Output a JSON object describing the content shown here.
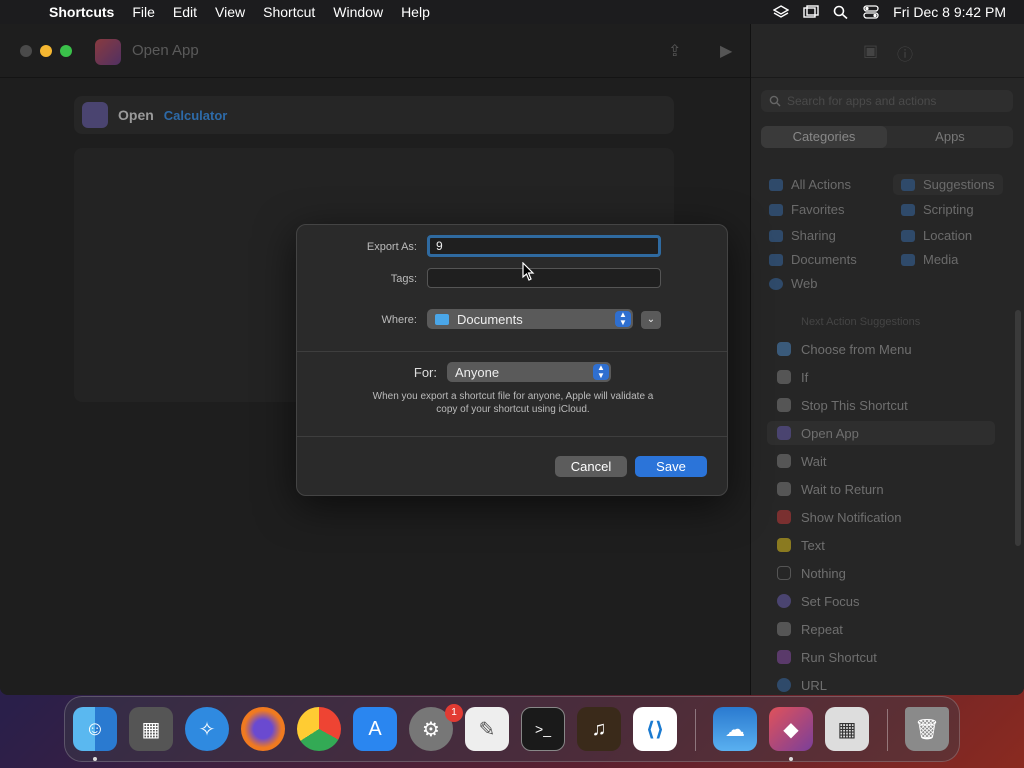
{
  "menubar": {
    "app": "Shortcuts",
    "items": [
      "File",
      "Edit",
      "View",
      "Shortcut",
      "Window",
      "Help"
    ],
    "clock": "Fri Dec 8  9:42 PM"
  },
  "window": {
    "title": "Open App",
    "action": {
      "verb": "Open",
      "app": "Calculator"
    }
  },
  "sidebar": {
    "search_placeholder": "Search for apps and actions",
    "tabs": [
      "Categories",
      "Apps"
    ],
    "categories_left": [
      "All Actions",
      "Favorites",
      "Sharing",
      "Documents",
      "Web"
    ],
    "categories_right": [
      "Suggestions",
      "Scripting",
      "Location",
      "Media"
    ],
    "next_label": "Next Action Suggestions",
    "suggestions": [
      "Choose from Menu",
      "If",
      "Stop This Shortcut",
      "Open App",
      "Wait",
      "Wait to Return",
      "Show Notification",
      "Text",
      "Nothing",
      "Set Focus",
      "Repeat",
      "Run Shortcut",
      "URL"
    ]
  },
  "dialog": {
    "export_label": "Export As:",
    "export_value": "9",
    "tags_label": "Tags:",
    "where_label": "Where:",
    "where_value": "Documents",
    "for_label": "For:",
    "for_value": "Anyone",
    "note": "When you export a shortcut file for anyone, Apple will validate a copy of your shortcut using iCloud.",
    "cancel": "Cancel",
    "save": "Save"
  },
  "dock": {
    "badge": "1"
  },
  "colors": {
    "accent": "#2b74d9",
    "focus_ring": "#2f6aa0"
  }
}
